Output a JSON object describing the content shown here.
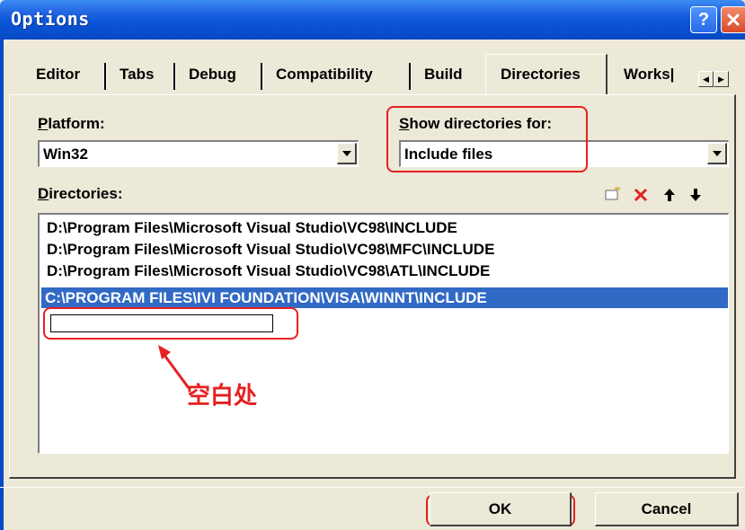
{
  "window": {
    "title": "Options"
  },
  "tabs": [
    {
      "label": "Editor"
    },
    {
      "label": "Tabs"
    },
    {
      "label": "Debug"
    },
    {
      "label": "Compatibility"
    },
    {
      "label": "Build"
    },
    {
      "label": "Directories"
    },
    {
      "label": "Works|"
    }
  ],
  "active_tab": "Directories",
  "platform": {
    "label_mnemonic": "P",
    "label_rest": "latform:",
    "value": "Win32"
  },
  "show_for": {
    "label_mnemonic": "S",
    "label_rest": "how directories for:",
    "value": "Include files"
  },
  "directories": {
    "label_mnemonic": "D",
    "label_rest": "irectories:",
    "items": [
      "D:\\Program Files\\Microsoft Visual Studio\\VC98\\INCLUDE",
      "D:\\Program Files\\Microsoft Visual Studio\\VC98\\MFC\\INCLUDE",
      "D:\\Program Files\\Microsoft Visual Studio\\VC98\\ATL\\INCLUDE",
      "C:\\PROGRAM FILES\\IVI FOUNDATION\\VISA\\WINNT\\INCLUDE"
    ],
    "selected_index": 3
  },
  "annotation": {
    "text": "空白处",
    "color": "#E62020"
  },
  "buttons": {
    "ok": "OK",
    "cancel": "Cancel"
  },
  "colors": {
    "selection": "#316AC5",
    "dialog_bg": "#ECE9D8",
    "titlebar": "#0A55D8"
  },
  "icons": [
    "help-icon",
    "close-icon",
    "new-folder-icon",
    "delete-icon",
    "move-up-icon",
    "move-down-icon",
    "dropdown-arrow-icon",
    "red-arrow-icon"
  ]
}
